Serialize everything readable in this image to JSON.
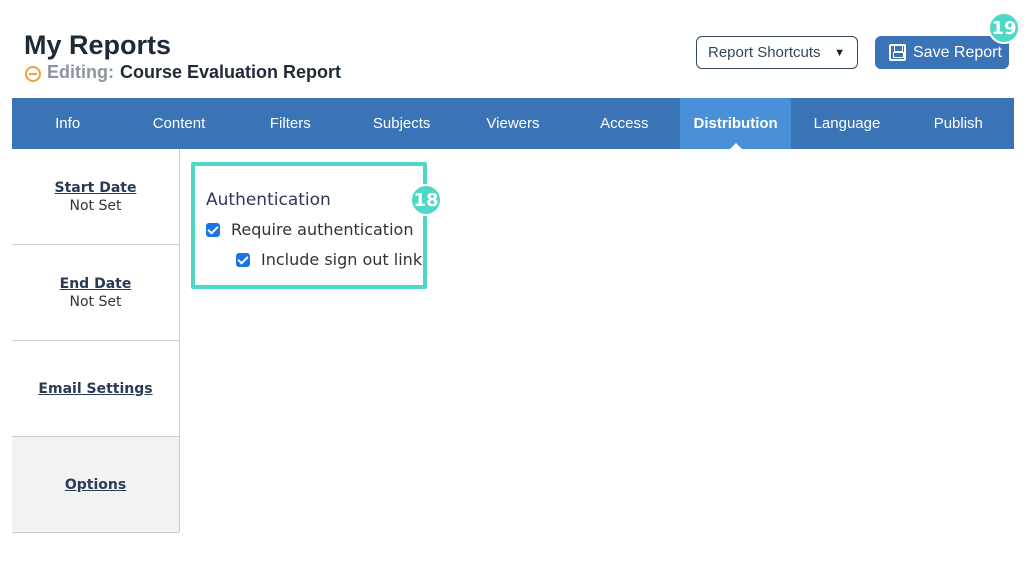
{
  "header": {
    "title": "My Reports",
    "editing_label": "Editing:",
    "report_name": "Course Evaluation Report",
    "shortcuts_label": "Report Shortcuts",
    "save_label": "Save Report"
  },
  "badges": {
    "save": "19",
    "auth": "18"
  },
  "tabs": [
    {
      "label": "Info"
    },
    {
      "label": "Content"
    },
    {
      "label": "Filters"
    },
    {
      "label": "Subjects"
    },
    {
      "label": "Viewers"
    },
    {
      "label": "Access"
    },
    {
      "label": "Distribution",
      "active": true
    },
    {
      "label": "Language"
    },
    {
      "label": "Publish"
    }
  ],
  "sidebar": {
    "items": [
      {
        "label": "Start Date",
        "value": "Not Set"
      },
      {
        "label": "End Date",
        "value": "Not Set"
      },
      {
        "label": "Email Settings"
      },
      {
        "label": "Options",
        "active": true
      }
    ]
  },
  "auth": {
    "heading": "Authentication",
    "require_label": "Require authentication",
    "require_checked": true,
    "signout_label": "Include sign out link",
    "signout_checked": true
  },
  "colors": {
    "primary": "#3a73b6",
    "active_tab": "#4a90d9",
    "highlight": "#4fd8c8",
    "status": "#f0a043"
  }
}
